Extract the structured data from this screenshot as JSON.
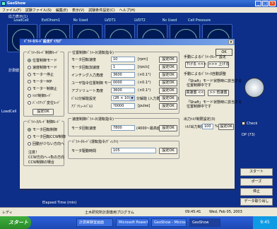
{
  "window": {
    "title": "GeoShow"
  },
  "menu": [
    "ファイル(F)",
    "試験ファイル(S)",
    "編集(E)",
    "表示(V)",
    "試験条件設定(C)",
    "ヘルプ(H)"
  ],
  "main": {
    "section_stress": "応力表示(1)",
    "headers": [
      "LoadCell",
      "ExtDhom1",
      "Nc Used",
      "LVDT1",
      "LVDT2",
      "Nc Used",
      "Cell Pressure"
    ],
    "section_disp": "計測値表示(2)",
    "loadcell_label": "LoadCell",
    "elapsed_label": "Elapsed Time (min)",
    "right": {
      "check_label": "Check",
      "dp_label": "DP (73)",
      "start_btn": "スタート",
      "pause_btn": "ポーズ",
      "stop_btn": "停止",
      "data_btn": "データ取り出し"
    }
  },
  "status": {
    "left": "レディ",
    "center": "土木研究所計測専用プログラム",
    "time": "09:45:41",
    "date": "Wed, Feb 05, 2003"
  },
  "taskbar": {
    "start": "スタート",
    "tasks": [
      "計測実験室画面",
      "Microsoft PowerPoint",
      "GeoShow - Micros...",
      "GeoShow"
    ],
    "clock": "9:45"
  },
  "dialog": {
    "title": "ﾊﾟﾗﾒｰﾀ/ﾓｰﾄﾞ設定ﾀﾞｲｱﾛｸﾞ",
    "ok": "OK",
    "mode_group": {
      "title": "ﾊﾟﾗﾒｰﾀﾓｰﾄﾞ制御ﾓｰﾄﾞ",
      "items": [
        "位置制御モード",
        "速度制御モード",
        "モーター停止",
        "モーターMP",
        "モーター制御止",
        "ﾄﾙｸ制御ﾓｰﾄﾞ",
        "ﾊﾞｯｸｱｯﾌﾟ変位ﾓｰﾄﾞ"
      ],
      "selected": 0,
      "set_btn": "設定OK"
    },
    "load_group": {
      "title": "ﾊﾟﾗﾒｰﾀ/ﾓｰﾄﾞ制御ﾓｰﾄﾞ",
      "items": [
        "モータ回転制御",
        "モータ回転CCW制御",
        "回動が少ない方向へ"
      ],
      "selected": 0,
      "note1": "注意！",
      "note2": "CCW方向へ→負の方向",
      "note3": "CCW制御の場合"
    },
    "pos_group": {
      "title": "位置制御ﾊﾟﾗﾒｰﾀ(運転指令)",
      "rows": [
        {
          "label": "モータ回転速度",
          "value": "10",
          "unit": "[rpm]",
          "btn": "設定OK"
        },
        {
          "label": "モータ回転加速度",
          "value": "1",
          "unit": "[rps/s]",
          "btn": "設定OK"
        },
        {
          "label": "インチング入力角度",
          "value": "3600",
          "unit": "(×0.1°)",
          "btn": "設定OK"
        },
        {
          "label": "ユーザ指令位置制御 モータ内部速度指令",
          "value": "0000",
          "unit": "(×0.1°)",
          "btn": "設定OK"
        },
        {
          "label": "アブソリュート角度",
          "value": "3600",
          "unit": "(×0.1°)",
          "btn": "設定OK"
        }
      ],
      "select_label": "ﾊﾟﾙｽ分解能設定",
      "select_value": "(2R × 10)",
      "select_note": "分解能 (入力数値から決定)",
      "select_btn": "設定OK",
      "last_label": "ｱﾌﾞｿﾘｭｰﾄﾊﾟﾙｽ",
      "last_value": "?0000",
      "last_unit": "[pulse]",
      "last_btn": "設定OK"
    },
    "speed_group": {
      "title": "速度制御ﾊﾟﾗﾒｰﾀ(運転指令)",
      "label": "モータ回転速度",
      "value": "7800",
      "unit": "(4000~最高値)",
      "btn": "設定OK"
    },
    "torque_group": {
      "title": "ﾊﾟﾗﾒｰﾀﾓｰﾄﾞ(運転指令/ﾃﾞｨﾚｸﾄ)",
      "label": "モータ駆動時間",
      "value": "105",
      "btn": "設定OK"
    },
    "right_notes": {
      "n1": "手動によるﾊﾟﾗﾒｰﾀﾓｰﾄﾞ設定",
      "down_btn": "下げる <<<",
      "up_btn": ">>> 上げる",
      "n2": "手動によるﾊﾟﾗﾒｰﾀ自動調整",
      "n3": "「Shaft」モード状態時に該当する",
      "n3b": "位置制御中です",
      "fast_btn": "高速置 <<",
      "slow_btn": ">> 低速置",
      "n4": "「Shaft」モード状態時に該当する",
      "n4b": "位置制御中です",
      "n5": "出力ﾄﾙｸ制限設定(3)",
      "n6": "ﾄﾙｸ出力制限値",
      "torque_value": "100",
      "torque_unit": "%",
      "torque_btn": "設定OK"
    }
  }
}
